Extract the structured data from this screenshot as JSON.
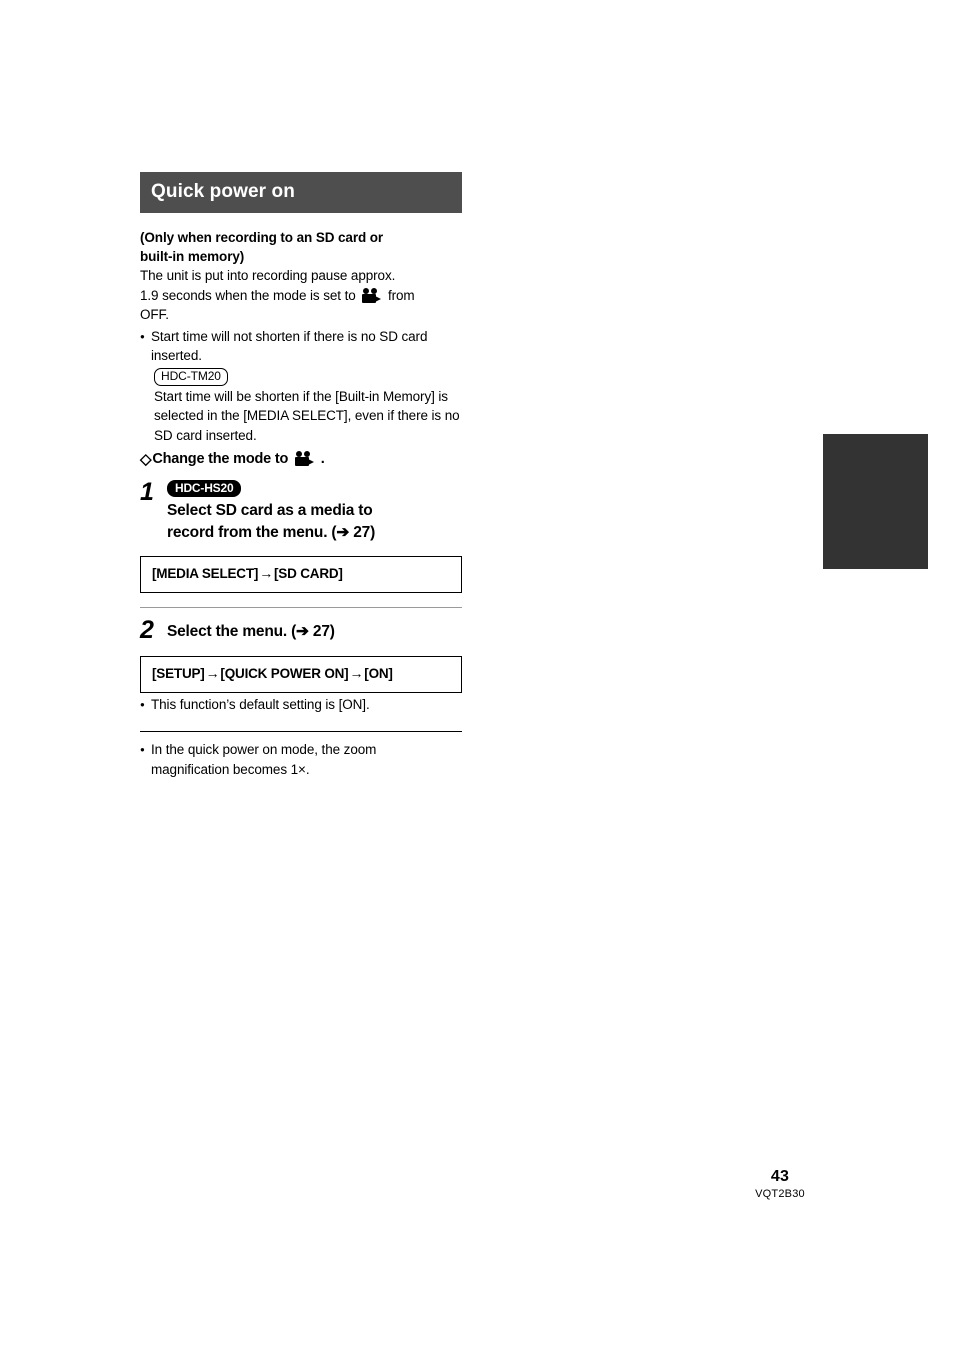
{
  "page": {
    "number": "43",
    "doc_code": "VQT2B30"
  },
  "section": {
    "header_title": "Quick power on",
    "header_bg": "#4e4e4e",
    "intro_bold_line1": "(Only when recording to an SD card or",
    "intro_bold_line2": "built-in memory)",
    "body_line1": "The unit is put into recording pause approx.",
    "body_line2_before_icon": "1.9 seconds when the mode is set to",
    "body_line2_after_icon": "from",
    "body_line3": "OFF.",
    "bullet1": "Start time will not shorten if there is no SD card inserted.",
    "note": {
      "badge": "HDC-TM20",
      "text": "Start time will be shorten if the [Built-in Memory] is selected in the [MEDIA SELECT], even if there is no SD card inserted."
    },
    "mode_heading": {
      "diamond": "◇",
      "text": "Change the mode to",
      "icon": "video-camera-mode-icon",
      "period": "."
    }
  },
  "steps": [
    {
      "number": "1",
      "badge": "HDC-HS20",
      "title_line1": "Select SD card as a media to",
      "title_line2": "record from the menu. (➔ 27)",
      "menu_path": {
        "items": [
          "[MEDIA SELECT]",
          "[SD CARD]"
        ],
        "arrow": "→"
      }
    },
    {
      "number": "2",
      "badge": "",
      "title_line1": "Select the menu. (➔ 27)",
      "title_line2": "",
      "menu_path": {
        "items": [
          "[SETUP]",
          "[QUICK POWER ON]",
          "[ON]"
        ],
        "arrow": "→"
      },
      "bullet": "This function’s default setting is [ON]."
    }
  ],
  "footnote": {
    "bullet_line1": "In the quick power on mode, the zoom",
    "bullet_line2": "magnification becomes 1×."
  }
}
